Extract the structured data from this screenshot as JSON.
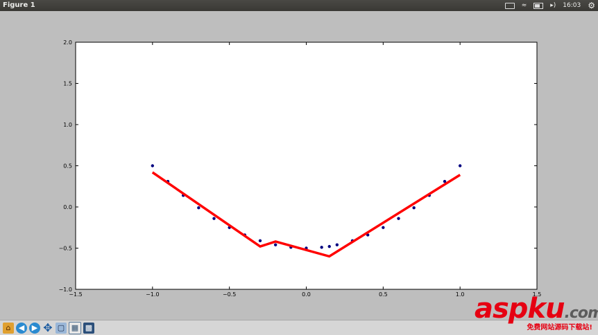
{
  "window": {
    "title": "Figure 1"
  },
  "tray": {
    "time": "16:03"
  },
  "toolbar": {
    "buttons": [
      "home-icon",
      "back-icon",
      "forward-icon",
      "pan-icon",
      "zoom-icon",
      "subplots-icon",
      "save-icon"
    ]
  },
  "watermark": {
    "brand_red": "aspku",
    "brand_gray": ".com",
    "tagline": "免费网站源码下载站!"
  },
  "colors": {
    "fit_line": "#ff0000",
    "points": "#000080",
    "figure_bg": "#bebebe",
    "axes_bg": "#ffffff"
  },
  "chart_data": {
    "type": "scatter",
    "title": "",
    "xlabel": "",
    "ylabel": "",
    "xlim": [
      -1.5,
      1.5
    ],
    "ylim": [
      -1.0,
      2.0
    ],
    "xticks": [
      "−1.5",
      "−1.0",
      "−0.5",
      "0.0",
      "0.5",
      "1.0",
      "1.5"
    ],
    "yticks": [
      "−1.0",
      "−0.5",
      "0.0",
      "0.5",
      "1.0",
      "1.5",
      "2.0"
    ],
    "grid": false,
    "series": [
      {
        "kind": "scatter",
        "x": [
          -1.0,
          -0.9,
          -0.8,
          -0.7,
          -0.6,
          -0.5,
          -0.4,
          -0.3,
          -0.2,
          -0.1,
          0.0,
          0.1,
          0.15,
          0.2,
          0.3,
          0.4,
          0.5,
          0.6,
          0.7,
          0.8,
          0.9,
          1.0
        ],
        "y": [
          0.5,
          0.31,
          0.14,
          -0.01,
          -0.14,
          -0.25,
          -0.34,
          -0.41,
          -0.46,
          -0.49,
          -0.5,
          -0.49,
          -0.48,
          -0.46,
          -0.41,
          -0.34,
          -0.25,
          -0.14,
          -0.01,
          0.14,
          0.31,
          0.5
        ]
      },
      {
        "kind": "line",
        "x": [
          -1.0,
          -0.3,
          -0.2,
          0.15,
          1.0
        ],
        "y": [
          0.42,
          -0.48,
          -0.42,
          -0.6,
          0.39
        ]
      }
    ]
  }
}
